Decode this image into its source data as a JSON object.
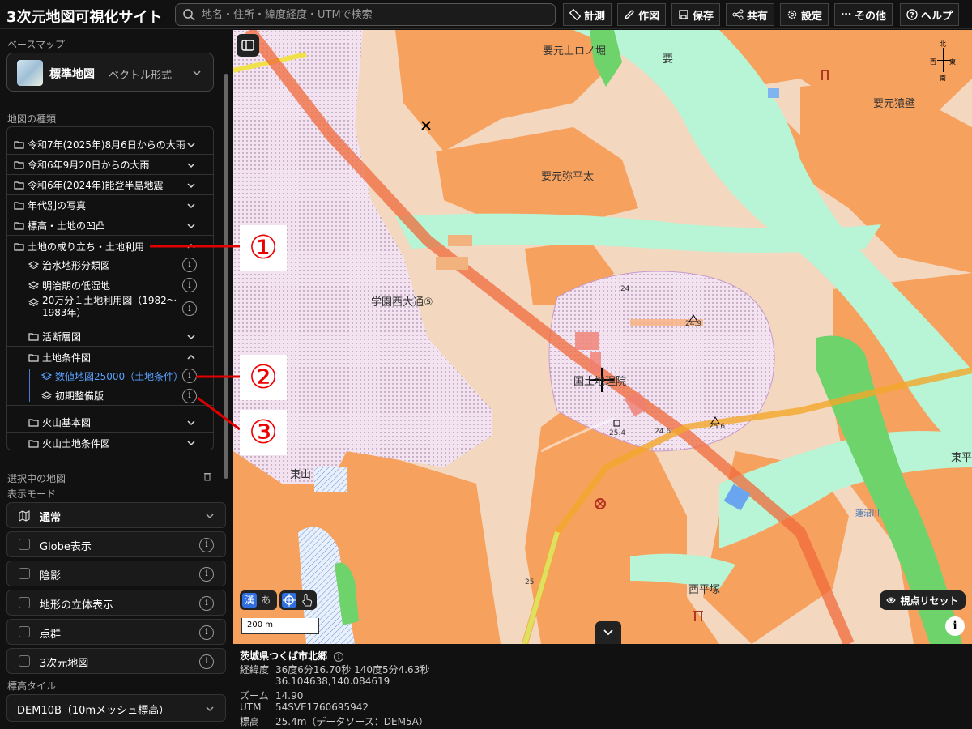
{
  "app": {
    "title": "3次元地図可視化サイト"
  },
  "search": {
    "placeholder": "地名・住所・緯度経度・UTMで検索"
  },
  "toolbar": [
    {
      "label": "計測",
      "icon": "ruler-icon"
    },
    {
      "label": "作図",
      "icon": "pencil-icon"
    },
    {
      "label": "保存",
      "icon": "save-icon"
    },
    {
      "label": "共有",
      "icon": "share-icon"
    },
    {
      "label": "設定",
      "icon": "gear-icon"
    },
    {
      "label": "その他",
      "icon": "more-icon"
    },
    {
      "label": "ヘルプ",
      "icon": "help-icon"
    }
  ],
  "sidebar": {
    "basemap_label": "ベースマップ",
    "basemap_name": "標準地図",
    "basemap_sub": "ベクトル形式",
    "maptype_label": "地図の種類",
    "tree": [
      {
        "label": "令和7年(2025年)8月6日からの大雨"
      },
      {
        "label": "令和6年9月20日からの大雨"
      },
      {
        "label": "令和6年(2024年)能登半島地震"
      },
      {
        "label": "年代別の写真"
      },
      {
        "label": "標高・土地の凹凸"
      },
      {
        "label": "土地の成り立ち・土地利用"
      },
      {
        "label": "治水地形分類図"
      },
      {
        "label": "明治期の低湿地"
      },
      {
        "label": "20万分１土地利用図（1982〜"
      },
      {
        "label": "1983年）"
      },
      {
        "label": "活断層図"
      },
      {
        "label": "土地条件図"
      },
      {
        "label": "数値地図25000（土地条件）"
      },
      {
        "label": "初期整備版"
      },
      {
        "label": "火山基本図"
      },
      {
        "label": "火山土地条件図"
      }
    ],
    "selected_label": "選択中の地図",
    "display_mode_label": "表示モード",
    "mode_value": "通常",
    "toggles": [
      "Globe表示",
      "陰影",
      "地形の立体表示",
      "点群",
      "3次元地図"
    ],
    "elev_tile_label": "標高タイル",
    "elev_tile_value": "DEM10B（10mメッシュ標高）"
  },
  "map": {
    "labels": {
      "kanamoto_kaminobori": "要元上ロノ堀",
      "kaname": "要",
      "kanamoto_saruka": "要元猿壁",
      "kanamoto_yaheita": "要元弥平太",
      "gakuen": "学園西大通⑤",
      "kokudo": "国土地理院",
      "higashiyama": "東山",
      "nishihiratsuka": "西平塚",
      "higashi": "東平",
      "hasunuma": "蓮沼川",
      "e24": "24",
      "e249": "24.9",
      "e254": "25.4",
      "e246": "24.6",
      "e256": "25.6",
      "e25": "25"
    },
    "compass": {
      "n": "北",
      "s": "南",
      "e": "東",
      "w": "西"
    },
    "scale": "200 m",
    "lang_kanji": "漢",
    "lang_kana": "あ",
    "view_reset": "視点リセット"
  },
  "info": {
    "place": "茨城県つくば市北郷",
    "latlon_label": "経緯度",
    "latlon_dms": "36度6分16.70秒 140度5分4.63秒",
    "latlon_dec": "36.104638,140.084619",
    "zoom_label": "ズーム",
    "zoom": "14.90",
    "utm_label": "UTM",
    "utm": "54SVE1760695942",
    "elev_label": "標高",
    "elev": "25.4m（データソース：DEM5A）"
  },
  "annotations": [
    "①",
    "②",
    "③"
  ],
  "colors": {
    "accent": "#2f6fe0",
    "annotation_red": "#e00000",
    "terrace_orange": "#f7a15f",
    "lowland_green": "#b8f5d6",
    "landfill_pink": "#f1dff1"
  }
}
